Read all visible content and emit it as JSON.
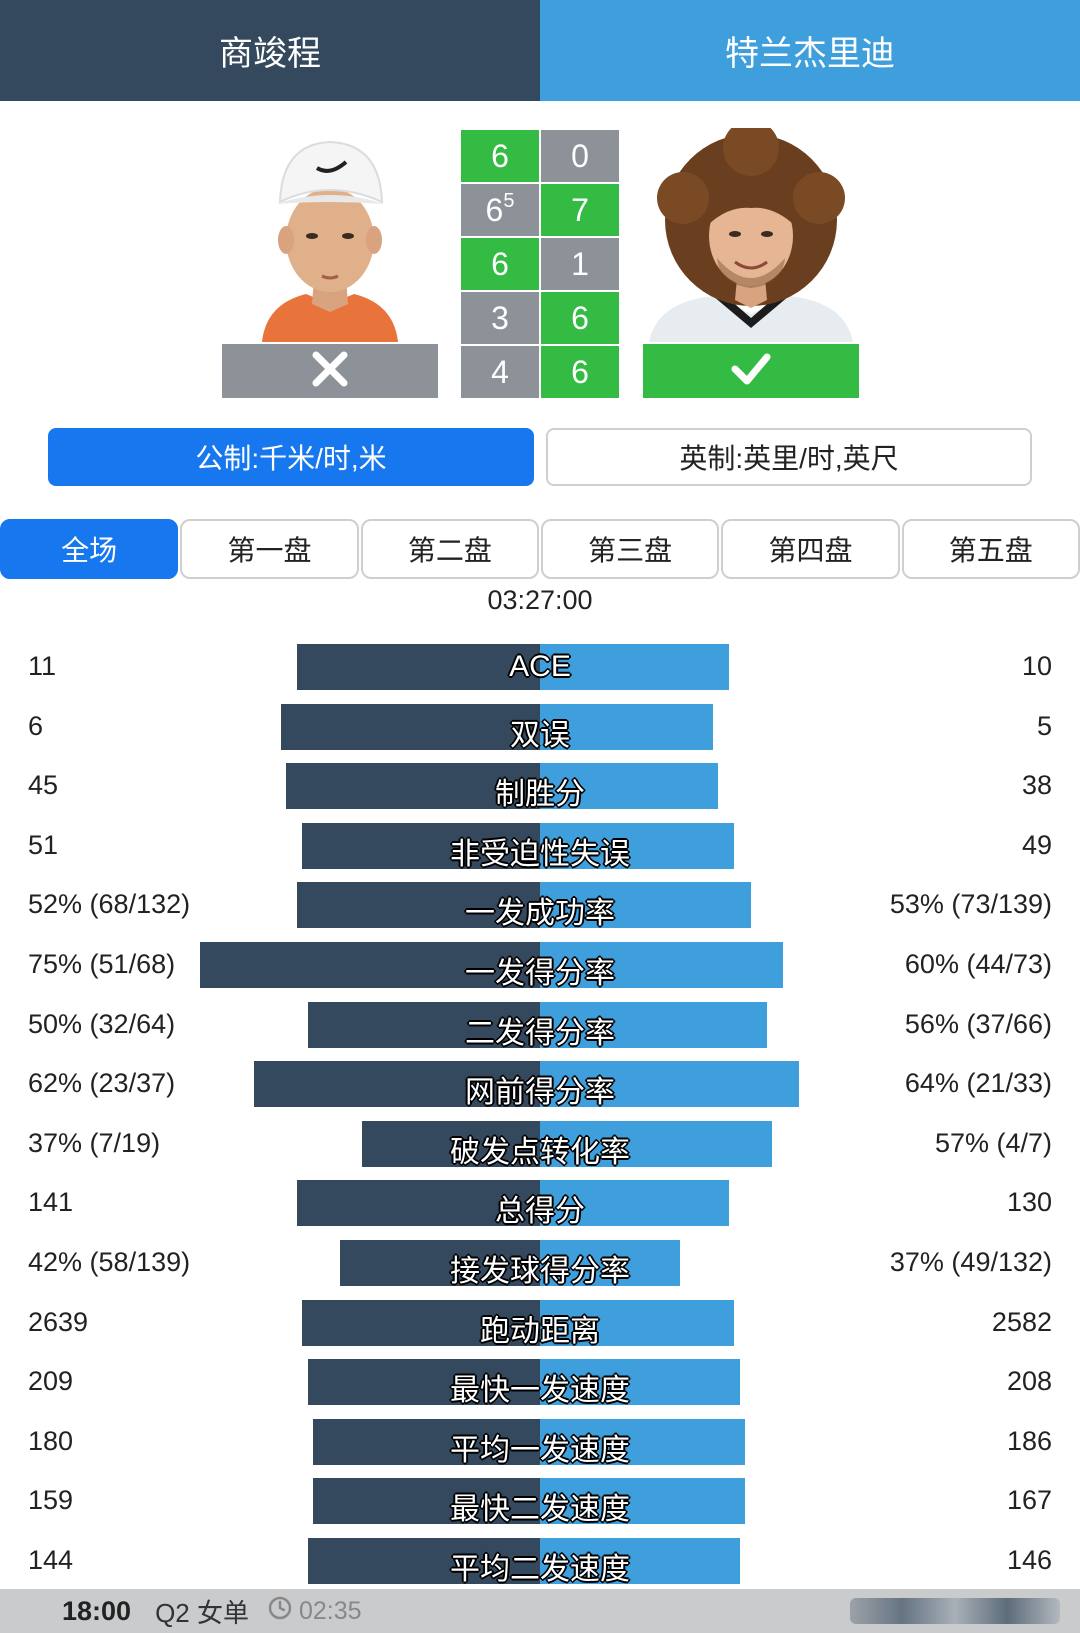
{
  "header": {
    "player1": "商竣程",
    "player2": "特兰杰里迪"
  },
  "players": {
    "left": {
      "photo_icon": "player-photo",
      "result_icon": "cross-icon"
    },
    "right": {
      "photo_icon": "player-photo",
      "result_icon": "check-icon"
    }
  },
  "scores": [
    {
      "p1": "6",
      "p2": "0",
      "winner": "p1"
    },
    {
      "p1": "6",
      "p1_tb": "5",
      "p2": "7",
      "winner": "p2"
    },
    {
      "p1": "6",
      "p2": "1",
      "winner": "p1"
    },
    {
      "p1": "3",
      "p2": "6",
      "winner": "p2"
    },
    {
      "p1": "4",
      "p2": "6",
      "winner": "p2"
    }
  ],
  "units": {
    "metric": "公制:千米/时,米",
    "imperial": "英制:英里/时,英尺",
    "selected": "metric"
  },
  "set_tabs": [
    "全场",
    "第一盘",
    "第二盘",
    "第三盘",
    "第四盘",
    "第五盘"
  ],
  "selected_tab": "全场",
  "duration": "03:27:00",
  "colors": {
    "player1": "#34495e",
    "player2": "#3e9fdc",
    "win": "#33bb44",
    "lose": "#8c9297",
    "accent": "#1677ee"
  },
  "stats": [
    {
      "label": "ACE",
      "left": "11",
      "right": "10",
      "left_bar": 0.45,
      "right_bar": 0.35
    },
    {
      "label": "双误",
      "left": "6",
      "right": "5",
      "left_bar": 0.48,
      "right_bar": 0.32
    },
    {
      "label": "制胜分",
      "left": "45",
      "right": "38",
      "left_bar": 0.47,
      "right_bar": 0.33
    },
    {
      "label": "非受迫性失误",
      "left": "51",
      "right": "49",
      "left_bar": 0.44,
      "right_bar": 0.36
    },
    {
      "label": "一发成功率",
      "left": "52% (68/132)",
      "right": "53% (73/139)",
      "left_bar": 0.45,
      "right_bar": 0.39
    },
    {
      "label": "一发得分率",
      "left": "75% (51/68)",
      "right": "60% (44/73)",
      "left_bar": 0.63,
      "right_bar": 0.45
    },
    {
      "label": "二发得分率",
      "left": "50% (32/64)",
      "right": "56% (37/66)",
      "left_bar": 0.43,
      "right_bar": 0.42
    },
    {
      "label": "网前得分率",
      "left": "62% (23/37)",
      "right": "64% (21/33)",
      "left_bar": 0.53,
      "right_bar": 0.48
    },
    {
      "label": "破发点转化率",
      "left": "37% (7/19)",
      "right": "57% (4/7)",
      "left_bar": 0.33,
      "right_bar": 0.43
    },
    {
      "label": "总得分",
      "left": "141",
      "right": "130",
      "left_bar": 0.45,
      "right_bar": 0.35
    },
    {
      "label": "接发球得分率",
      "left": "42% (58/139)",
      "right": "37% (49/132)",
      "left_bar": 0.37,
      "right_bar": 0.26
    },
    {
      "label": "跑动距离",
      "left": "2639",
      "right": "2582",
      "left_bar": 0.44,
      "right_bar": 0.36
    },
    {
      "label": "最快一发速度",
      "left": "209",
      "right": "208",
      "left_bar": 0.43,
      "right_bar": 0.37
    },
    {
      "label": "平均一发速度",
      "left": "180",
      "right": "186",
      "left_bar": 0.42,
      "right_bar": 0.38
    },
    {
      "label": "最快二发速度",
      "left": "159",
      "right": "167",
      "left_bar": 0.42,
      "right_bar": 0.38
    },
    {
      "label": "平均二发速度",
      "left": "144",
      "right": "146",
      "left_bar": 0.43,
      "right_bar": 0.37
    }
  ],
  "ticker": {
    "time": "18:00",
    "tournament": "Q2 女单",
    "elapsed": "02:35",
    "clock_icon": "clock-icon"
  }
}
